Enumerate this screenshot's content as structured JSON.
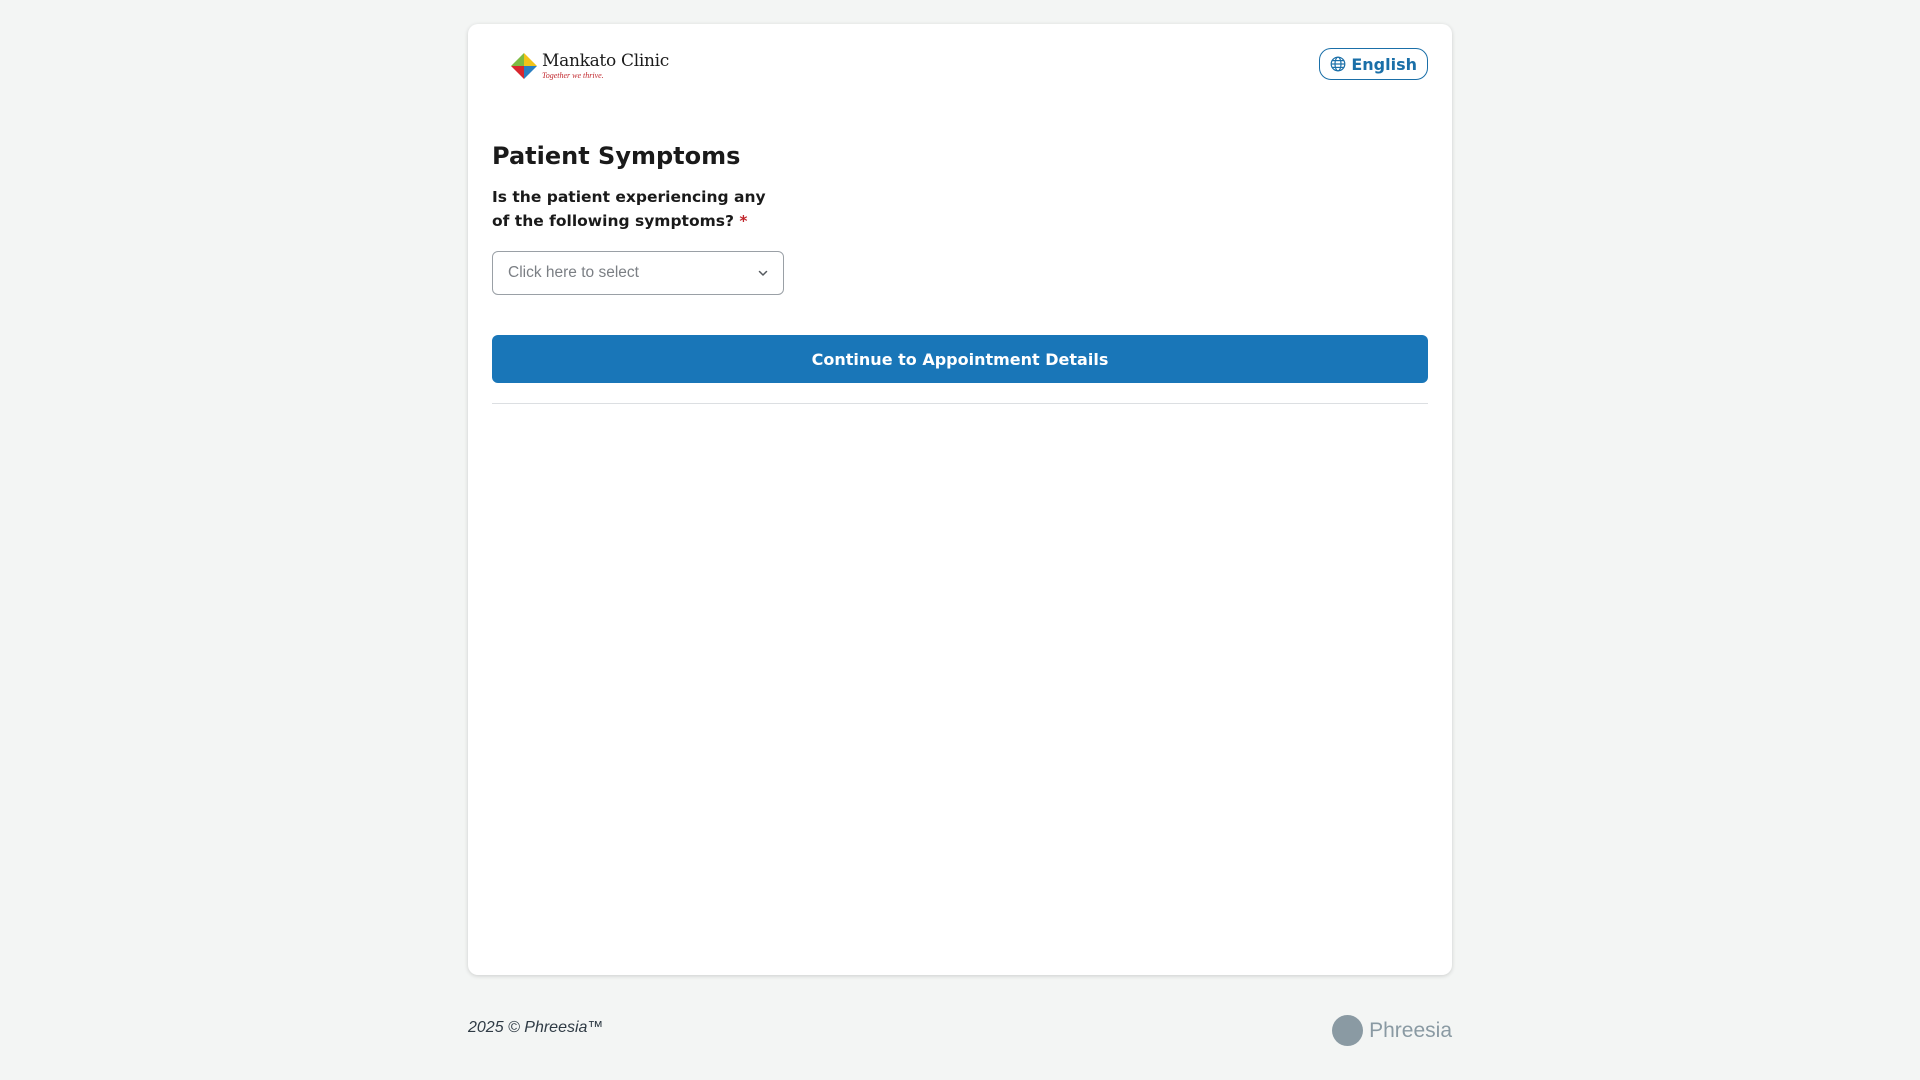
{
  "header": {
    "logo": {
      "name": "Mankato Clinic",
      "tagline": "Together we thrive."
    },
    "language_button": {
      "label": "English",
      "icon": "globe-icon"
    }
  },
  "form": {
    "title": "Patient Symptoms",
    "question": "Is the patient experiencing any of the following symptoms?",
    "required_marker": "*",
    "select": {
      "placeholder": "Click here to select",
      "icon": "chevron-down-icon"
    },
    "continue_label": "Continue to Appointment Details"
  },
  "footer": {
    "copyright": "2025 © Phreesia™",
    "brand": "Phreesia"
  },
  "colors": {
    "accent": "#1976b8",
    "required": "#c1272d",
    "background": "#f3f5f4"
  }
}
